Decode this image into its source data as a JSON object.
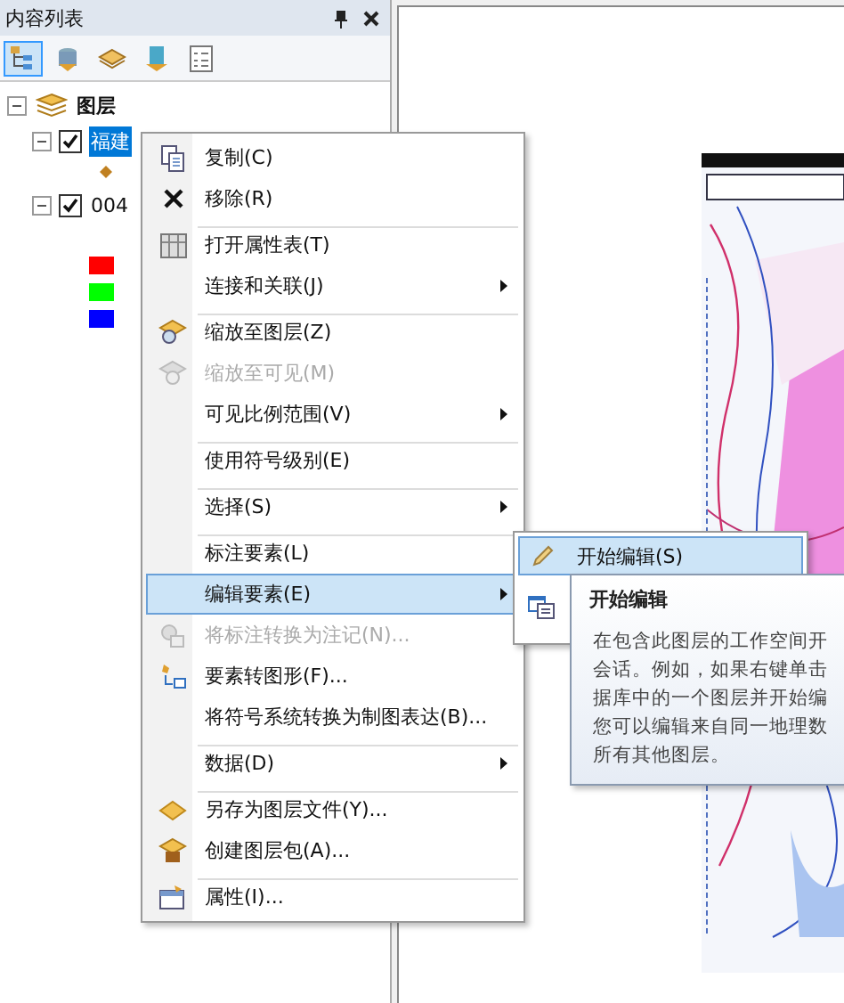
{
  "panel": {
    "title": "内容列表"
  },
  "toolbar_buttons": [
    {
      "selected": true
    },
    {
      "selected": false
    },
    {
      "selected": false
    },
    {
      "selected": false
    },
    {
      "selected": false
    }
  ],
  "tree": {
    "label": "图层",
    "expanded": true,
    "children": [
      {
        "label": "福建",
        "checked": true,
        "expanded": true,
        "selected": true,
        "kind": "point"
      },
      {
        "label": "004",
        "checked": true,
        "expanded": true,
        "selected": false,
        "kind": "raster",
        "legend": [
          {
            "color": "#ff0000"
          },
          {
            "color": "#00ff00"
          },
          {
            "color": "#0000ff"
          }
        ]
      }
    ]
  },
  "context_menu": [
    {
      "label": "复制(C)",
      "disabled": false,
      "submenu": false,
      "selected": false,
      "separator_before": false
    },
    {
      "label": "移除(R)",
      "disabled": false,
      "submenu": false,
      "selected": false,
      "separator_before": false
    },
    {
      "label": "打开属性表(T)",
      "disabled": false,
      "submenu": false,
      "selected": false,
      "separator_before": true
    },
    {
      "label": "连接和关联(J)",
      "disabled": false,
      "submenu": true,
      "selected": false,
      "separator_before": false
    },
    {
      "label": "缩放至图层(Z)",
      "disabled": false,
      "submenu": false,
      "selected": false,
      "separator_before": true
    },
    {
      "label": "缩放至可见(M)",
      "disabled": true,
      "submenu": false,
      "selected": false,
      "separator_before": false
    },
    {
      "label": "可见比例范围(V)",
      "disabled": false,
      "submenu": true,
      "selected": false,
      "separator_before": false
    },
    {
      "label": "使用符号级别(E)",
      "disabled": false,
      "submenu": false,
      "selected": false,
      "separator_before": true
    },
    {
      "label": "选择(S)",
      "disabled": false,
      "submenu": true,
      "selected": false,
      "separator_before": true
    },
    {
      "label": "标注要素(L)",
      "disabled": false,
      "submenu": false,
      "selected": false,
      "separator_before": true
    },
    {
      "label": "编辑要素(E)",
      "disabled": false,
      "submenu": true,
      "selected": true,
      "separator_before": false
    },
    {
      "label": "将标注转换为注记(N)...",
      "disabled": true,
      "submenu": false,
      "selected": false,
      "separator_before": false
    },
    {
      "label": "要素转图形(F)...",
      "disabled": false,
      "submenu": false,
      "selected": false,
      "separator_before": false
    },
    {
      "label": "将符号系统转换为制图表达(B)...",
      "disabled": false,
      "submenu": false,
      "selected": false,
      "separator_before": false
    },
    {
      "label": "数据(D)",
      "disabled": false,
      "submenu": true,
      "selected": false,
      "separator_before": true
    },
    {
      "label": "另存为图层文件(Y)...",
      "disabled": false,
      "submenu": false,
      "selected": false,
      "separator_before": true
    },
    {
      "label": "创建图层包(A)...",
      "disabled": false,
      "submenu": false,
      "selected": false,
      "separator_before": false
    },
    {
      "label": "属性(I)...",
      "disabled": false,
      "submenu": false,
      "selected": false,
      "separator_before": true
    }
  ],
  "submenu": [
    {
      "label": "开始编辑(S)",
      "selected": true
    }
  ],
  "tooltip": {
    "title": "开始编辑",
    "lines": [
      "在包含此图层的工作空间开",
      "会话。例如，如果右键单击",
      "据库中的一个图层并开始编",
      "您可以编辑来自同一地理数",
      "所有其他图层。"
    ]
  }
}
